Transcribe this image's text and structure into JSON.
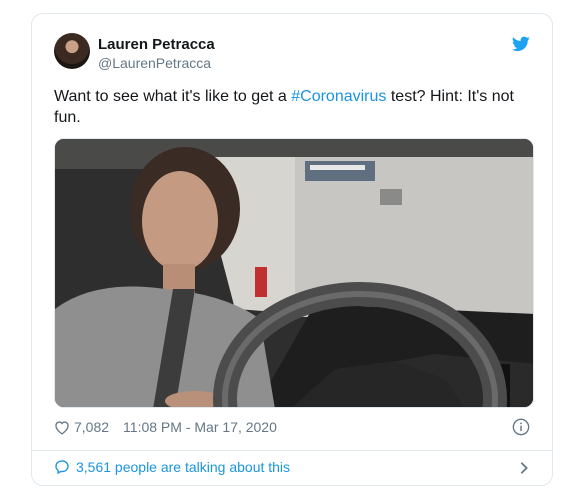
{
  "tweet": {
    "author_name": "Lauren Petracca",
    "author_handle": "@LaurenPetracca",
    "text_before": "Want to see what it's like to get a ",
    "hashtag": "#Coronavirus",
    "text_after": " test? Hint: It's not fun.",
    "likes": "7,082",
    "timestamp": "11:08 PM - Mar 17, 2020",
    "talking": "3,561 people are talking about this"
  },
  "icons": {
    "brand": "twitter-bird-icon",
    "like": "heart-icon",
    "info": "info-icon",
    "reply": "comment-icon",
    "arrow": "chevron-right-icon"
  },
  "colors": {
    "accent": "#1b95e0",
    "muted": "#657786",
    "text": "#14171a",
    "border": "#e1e8ed"
  }
}
